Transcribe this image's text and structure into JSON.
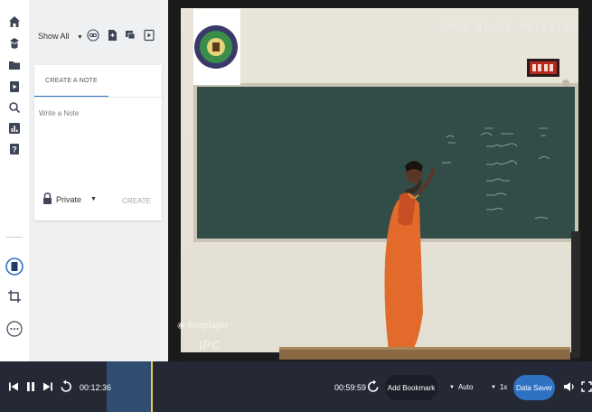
{
  "rail": {
    "icons": [
      "home-icon",
      "graduation-cap-icon",
      "folder-icon",
      "video-file-icon",
      "search-icon",
      "bar-chart-icon",
      "help-icon",
      "notebook-icon",
      "crop-icon",
      "more-icon"
    ]
  },
  "notes": {
    "filter_label": "Show All",
    "toolbar_icons": [
      "link-icon",
      "document-icon",
      "chat-icon",
      "video-icon"
    ],
    "tab_label": "CREATE A NOTE",
    "input_placeholder": "Write a Note",
    "privacy_label": "Private",
    "create_label": "CREATE"
  },
  "video": {
    "overlay_timestamp": "2000-01-03 00:27:58",
    "watermark_player": "flowplayer",
    "watermark_ipc": "IPC",
    "board_text": [
      "(s−1)/s",
      "t ≥ 1",
      "Σ",
      "ηr",
      "Ts",
      "TX",
      "Tc",
      "MSE",
      "DMS"
    ]
  },
  "player": {
    "current_time": "00:12:36",
    "duration": "00:59:59",
    "played_fraction": 0.21,
    "buffered_fraction": 0.28,
    "bookmark_label": "Add Bookmark",
    "quality_label": "Auto",
    "speed_label": "1x",
    "data_saver_label": "Data Saver",
    "icons": [
      "skip-back-icon",
      "pause-icon",
      "skip-forward-icon",
      "rewind-10-icon",
      "forward-10-icon",
      "volume-icon",
      "fullscreen-icon"
    ]
  }
}
